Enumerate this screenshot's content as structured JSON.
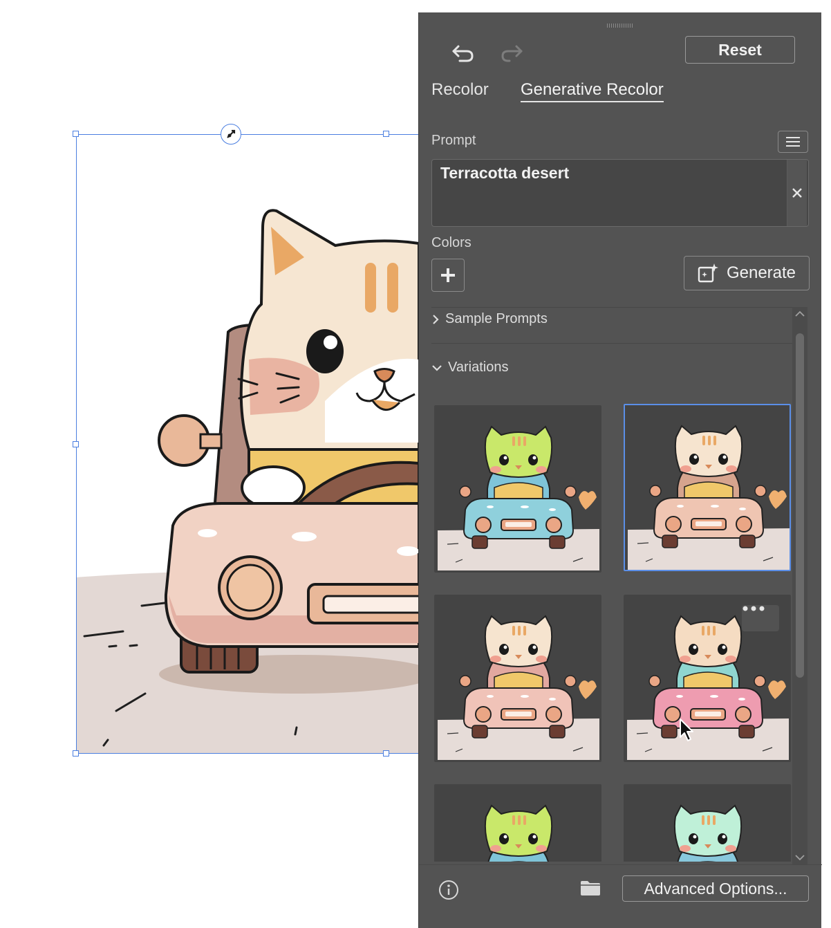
{
  "toolbar": {
    "undo_icon": "undo-icon",
    "redo_icon": "redo-icon",
    "reset_label": "Reset"
  },
  "tabs": [
    {
      "label": "Recolor",
      "active": false
    },
    {
      "label": "Generative Recolor",
      "active": true
    }
  ],
  "prompt": {
    "label": "Prompt",
    "value": "Terracotta desert",
    "menu_icon": "hamburger-menu-icon",
    "clear_icon": "close-icon"
  },
  "colors": {
    "label": "Colors",
    "add_icon": "plus-icon"
  },
  "generate": {
    "label": "Generate",
    "icon": "generate-sparkle-icon"
  },
  "sample_prompts": {
    "label": "Sample Prompts",
    "expanded": false
  },
  "variations": {
    "label": "Variations",
    "expanded": true,
    "items": [
      {
        "name": "variation-1",
        "head": "#c9e86a",
        "car": "#8fd0dc",
        "seat": "#7fc4d8",
        "selected": false
      },
      {
        "name": "variation-2",
        "head": "#f6e4cf",
        "car": "#efc5b2",
        "seat": "#d6a48e",
        "selected": true
      },
      {
        "name": "variation-3",
        "head": "#f6e4cf",
        "car": "#f0c3b8",
        "seat": "#e2a8a0",
        "selected": false
      },
      {
        "name": "variation-4",
        "head": "#f5dcc2",
        "car": "#ee9cb0",
        "seat": "#8fd6d0",
        "selected": false
      },
      {
        "name": "variation-5",
        "head": "#c9e86a",
        "car": "#8fd0dc",
        "seat": "#7fc4d8",
        "selected": false
      },
      {
        "name": "variation-6",
        "head": "#bff0d8",
        "car": "#9fd8e8",
        "seat": "#88c8dc",
        "selected": false
      }
    ]
  },
  "footer": {
    "info_icon": "info-icon",
    "folder_icon": "folder-icon",
    "advanced_label": "Advanced Options..."
  },
  "colors_palette": {
    "panel_bg": "#535353",
    "selection_blue": "#5b8fe8"
  }
}
